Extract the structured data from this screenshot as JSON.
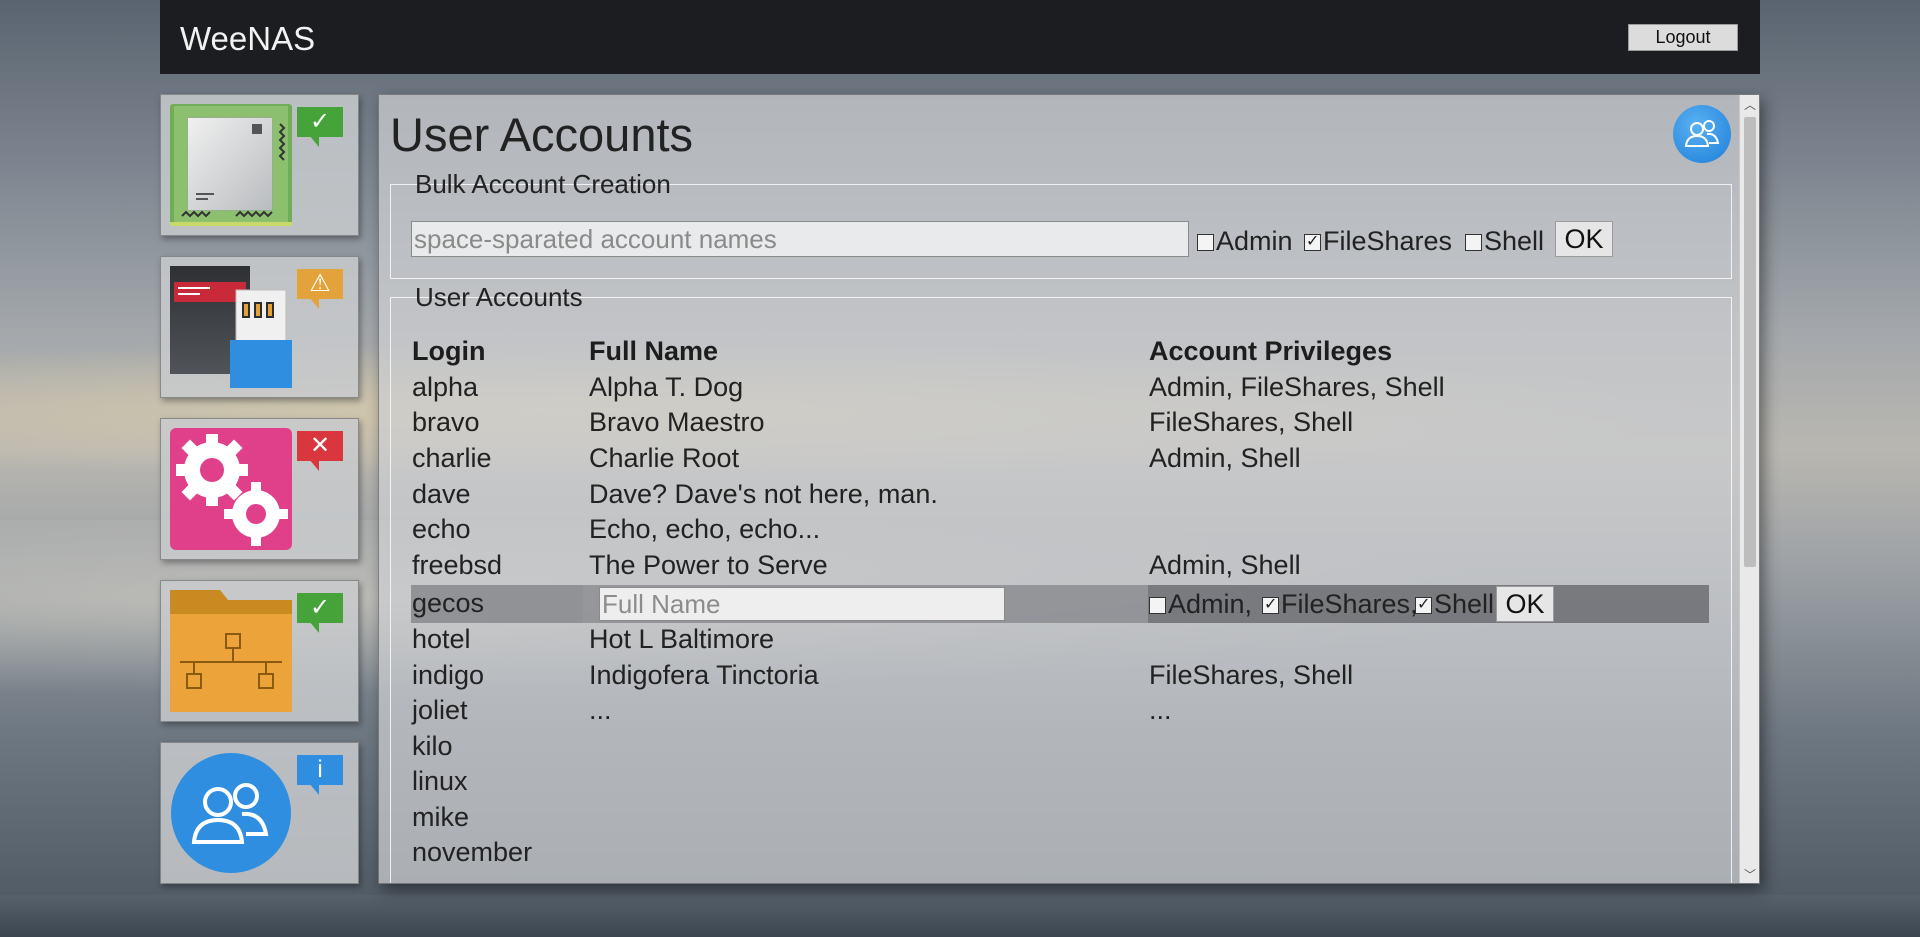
{
  "app": {
    "title": "WeeNAS",
    "logout_label": "Logout"
  },
  "tiles": [
    {
      "name": "system",
      "icon": "motherboard-icon",
      "status": "ok",
      "status_glyph": "✓",
      "status_color": "#45a33a"
    },
    {
      "name": "storage",
      "icon": "storage-devices-icon",
      "status": "warning",
      "status_glyph": "⚠",
      "status_color": "#e3a23a"
    },
    {
      "name": "services",
      "icon": "gears-icon",
      "status": "error",
      "status_glyph": "✕",
      "status_color": "#d9363e"
    },
    {
      "name": "shares",
      "icon": "network-folder-icon",
      "status": "ok",
      "status_glyph": "✓",
      "status_color": "#45a33a"
    },
    {
      "name": "users",
      "icon": "users-icon",
      "status": "info",
      "status_glyph": "i",
      "status_color": "#2f8ee0"
    }
  ],
  "page": {
    "title": "User Accounts",
    "icon": "users-icon"
  },
  "bulk": {
    "legend": "Bulk Account Creation",
    "placeholder": "space-sparated account names",
    "options": [
      {
        "label": "Admin",
        "checked": false
      },
      {
        "label": "FileShares",
        "checked": true
      },
      {
        "label": "Shell",
        "checked": false
      }
    ],
    "ok_label": "OK"
  },
  "accounts": {
    "legend": "User Accounts",
    "columns": [
      "Login",
      "Full Name",
      "Account Privileges"
    ],
    "rows": [
      {
        "login": "alpha",
        "full_name": "Alpha T. Dog",
        "privileges": "Admin, FileShares, Shell"
      },
      {
        "login": "bravo",
        "full_name": "Bravo Maestro",
        "privileges": "FileShares, Shell"
      },
      {
        "login": "charlie",
        "full_name": "Charlie Root",
        "privileges": "Admin, Shell"
      },
      {
        "login": "dave",
        "full_name": "Dave? Dave's not here, man.",
        "privileges": ""
      },
      {
        "login": "echo",
        "full_name": "Echo, echo, echo...",
        "privileges": ""
      },
      {
        "login": "freebsd",
        "full_name": "The Power to Serve",
        "privileges": "Admin, Shell"
      },
      {
        "login": "hotel",
        "full_name": "Hot L Baltimore",
        "privileges": ""
      },
      {
        "login": "indigo",
        "full_name": "Indigofera Tinctoria",
        "privileges": "FileShares, Shell"
      },
      {
        "login": "joliet",
        "full_name": "...",
        "privileges": "..."
      },
      {
        "login": "kilo",
        "full_name": "",
        "privileges": ""
      },
      {
        "login": "linux",
        "full_name": "",
        "privileges": ""
      },
      {
        "login": "mike",
        "full_name": "",
        "privileges": ""
      },
      {
        "login": "november",
        "full_name": "",
        "privileges": ""
      }
    ],
    "editing": {
      "login": "gecos",
      "full_name_placeholder": "Full Name",
      "options": [
        {
          "label": "Admin,",
          "checked": false
        },
        {
          "label": "FileShares,",
          "checked": true
        },
        {
          "label": "Shell",
          "checked": true
        }
      ],
      "ok_label": "OK"
    }
  }
}
